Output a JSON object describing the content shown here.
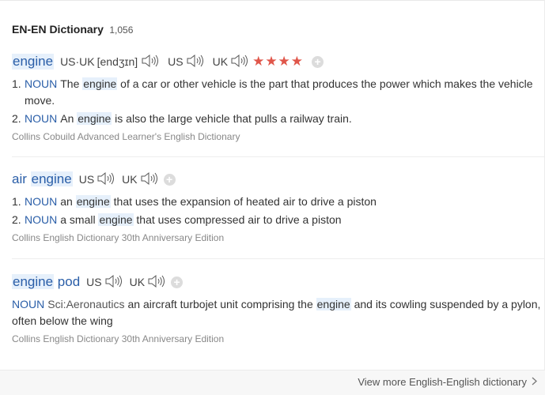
{
  "header": {
    "title": "EN-EN Dictionary",
    "count": "1,056"
  },
  "entries": [
    {
      "headword_parts": [
        "engine"
      ],
      "pron_region": "US·UK",
      "ipa": "[endʒɪn]",
      "us_label": "US",
      "uk_label": "UK",
      "stars": "★★★★",
      "add_label": "+",
      "senses": [
        {
          "num": "1.",
          "pos": "NOUN",
          "pre": "The ",
          "hl": "engine",
          "post": " of a car or other vehicle is the part that produces the power which makes the vehicle move."
        },
        {
          "num": "2.",
          "pos": "NOUN",
          "pre": "An ",
          "hl": "engine",
          "post": " is also the large vehicle that pulls a railway train."
        }
      ],
      "source": "Collins Cobuild Advanced Learner's English Dictionary"
    },
    {
      "headword_parts": [
        "air",
        "engine"
      ],
      "us_label": "US",
      "uk_label": "UK",
      "add_label": "+",
      "senses": [
        {
          "num": "1.",
          "pos": "NOUN",
          "pre": "an ",
          "hl": "engine",
          "post": " that uses the expansion of heated air to drive a piston"
        },
        {
          "num": "2.",
          "pos": "NOUN",
          "pre": "a small ",
          "hl": "engine",
          "post": " that uses compressed air to drive a piston"
        }
      ],
      "source": "Collins English Dictionary 30th Anniversary Edition"
    },
    {
      "headword_parts": [
        "engine",
        "pod"
      ],
      "us_label": "US",
      "uk_label": "UK",
      "add_label": "+",
      "sense": {
        "pos": "NOUN",
        "subject": "Sci:Aeronautics",
        "pre": "an aircraft turbojet unit comprising the ",
        "hl": "engine",
        "post": " and its cowling suspended by a pylon, often below the wing"
      },
      "source": "Collins English Dictionary 30th Anniversary Edition"
    }
  ],
  "footer": {
    "more_label": "View more English-English dictionary"
  },
  "colors": {
    "link": "#2a5ea8",
    "highlight_bg": "#e6f0fb",
    "stars": "#e0564a"
  }
}
